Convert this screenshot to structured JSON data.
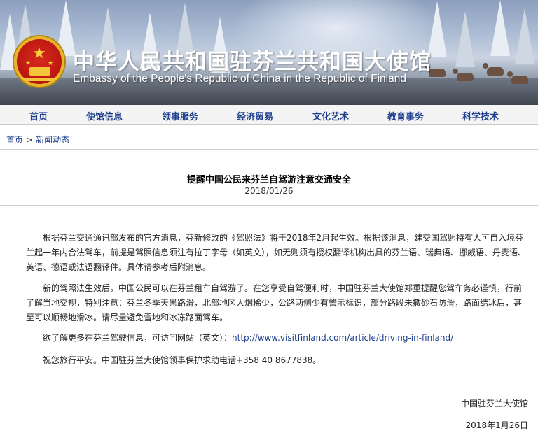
{
  "header": {
    "title_cn": "中华人民共和国驻芬兰共和国大使馆",
    "title_en": "Embassy of the People's Republic of China in the Republic of Finland"
  },
  "nav": {
    "items": [
      {
        "label": "首页"
      },
      {
        "label": "使馆信息"
      },
      {
        "label": "领事服务"
      },
      {
        "label": "经济贸易"
      },
      {
        "label": "文化艺术"
      },
      {
        "label": "教育事务"
      },
      {
        "label": "科学技术"
      }
    ]
  },
  "breadcrumb": {
    "home": "首页",
    "separator": ">",
    "current": "新闻动态"
  },
  "article": {
    "title": "提醒中国公民来芬兰自驾游注意交通安全",
    "date": "2018/01/26",
    "paragraph1": "根据芬兰交通通讯部发布的官方消息，芬新修改的《驾照法》将于2018年2月起生效。根据该消息，建交国驾照持有人可自入境芬兰起一年内合法驾车，前提是驾照信息须注有拉丁字母（如英文），如无则须有授权翻译机构出具的芬兰语、瑞典语、挪威语、丹麦语、英语、德语或法语翻译件。具体请参考后附消息。",
    "paragraph2": "新的驾照法生效后，中国公民可以在芬兰租车自驾游了。在您享受自驾便利时，中国驻芬兰大使馆郑重提醒您驾车务必谨慎，行前了解当地交规，特别注意：芬兰冬季天黑路滑，北部地区人烟稀少，公路两侧少有警示标识，部分路段未撒砂石防滑，路面结冰后，甚至可以顺畅地滑冰。请尽量避免雪地和冰冻路面驾车。",
    "paragraph3_prefix": "欲了解更多在芬兰驾驶信息，可访问网站（英文）：",
    "paragraph3_link": "http://www.visitfinland.com/article/driving-in-finland/",
    "paragraph4": "祝您旅行平安。中国驻芬兰大使馆领事保护求助电话+358 40 8677838。",
    "signature": "中国驻芬兰大使馆",
    "signature_date": "2018年1月26日"
  },
  "colors": {
    "nav_text": "#1f3f8f",
    "link": "#1f3f8f",
    "emblem_red": "#c21b13",
    "emblem_gold": "#e8b52a"
  }
}
